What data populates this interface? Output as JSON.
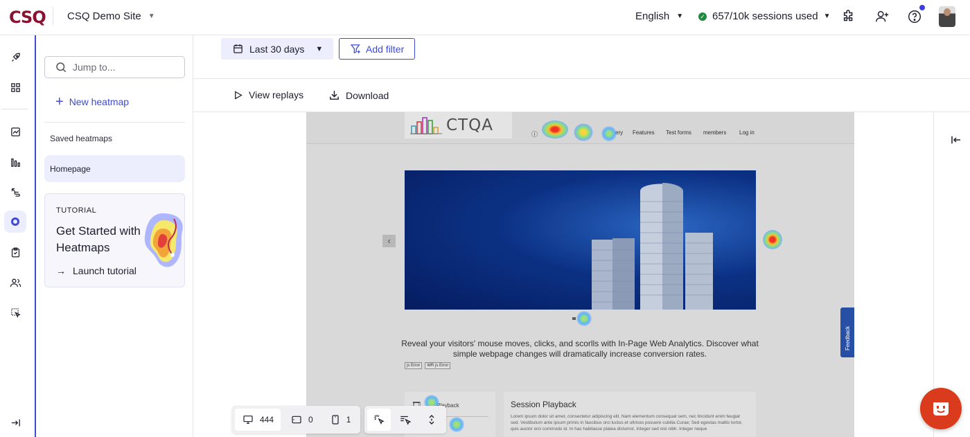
{
  "header": {
    "logo": "CSQ",
    "site_name": "CSQ Demo Site",
    "language": "English",
    "sessions": "657/10k sessions used"
  },
  "rail": {
    "items": [
      "rocket-icon",
      "apps-icon",
      "trend-icon",
      "bar-chart-icon",
      "journey-icon",
      "heatmap-icon",
      "checklist-icon",
      "users-icon",
      "selection-icon"
    ],
    "active": "heatmap-icon",
    "collapse": "collapse-icon"
  },
  "panel": {
    "search_placeholder": "Jump to...",
    "new_heatmap": "New heatmap",
    "saved_label": "Saved heatmaps",
    "saved_items": [
      "Homepage"
    ],
    "tutorial": {
      "label": "TUTORIAL",
      "title": "Get Started with Heatmaps",
      "link": "Launch tutorial"
    }
  },
  "toolbar": {
    "date_range": "Last 30 days",
    "add_filter": "Add filter",
    "view_replays": "View replays",
    "download": "Download"
  },
  "preview": {
    "logo_text": "CTQA",
    "nav": [
      "ery",
      "Features",
      "Test forms",
      "members",
      "Log in"
    ],
    "text": "Reveal your visitors' mouse moves, clicks, and scorlls with In-Page Web Analytics. Discover what simple webpage changes will dramatically increase conversion rates.",
    "tags": [
      "js Error",
      "WR js Error"
    ],
    "card1_title": "on Playback",
    "card2_title": "Session Playback",
    "card2_body": "Lorem ipsum dolor sit amet, consectetur adipiscing elit. Nam elementum consequat sem, nec tincidunt enim feugiat sed. Vestibulum ante ipsum primis in faucibus orci luctus et ultrices posuere cubilia Curae; Sed egestas mattis tortor, quis auctor orci commodo id. In hac habitasse platea dictumst. Integer sed nisl nibh. Integer neque",
    "feedback": "Feedback"
  },
  "bottom": {
    "desktop_count": "444",
    "tablet_count": "0",
    "mobile_count": "1"
  },
  "colors": {
    "brand": "#8a1230",
    "accent": "#3d4bd6",
    "chat": "#d93b1c"
  }
}
